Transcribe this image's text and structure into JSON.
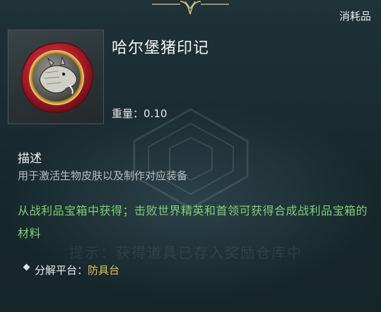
{
  "header": {
    "category": "消耗品"
  },
  "item": {
    "name": "哈尔堡猪印记",
    "icon": "boar-seal-icon",
    "weight_label": "重量：",
    "weight_value": "0.10"
  },
  "description": {
    "title": "描述",
    "text": "用于激活生物皮肤以及制作对应装备"
  },
  "source": {
    "text": "从战利品宝箱中获得；击败世界精英和首领可获得合成战利品宝箱的材料"
  },
  "watermark": {
    "hint": "提示：获得道具已存入奖励仓库中"
  },
  "dismantle": {
    "label": "分解平台：",
    "value": "防具台"
  },
  "colors": {
    "background": "#1b2d33",
    "source_green": "#7fcf73",
    "highlight_yellow": "#e2c34a",
    "seal_red": "#b3202b",
    "ornament_gold": "#c8b06a"
  }
}
